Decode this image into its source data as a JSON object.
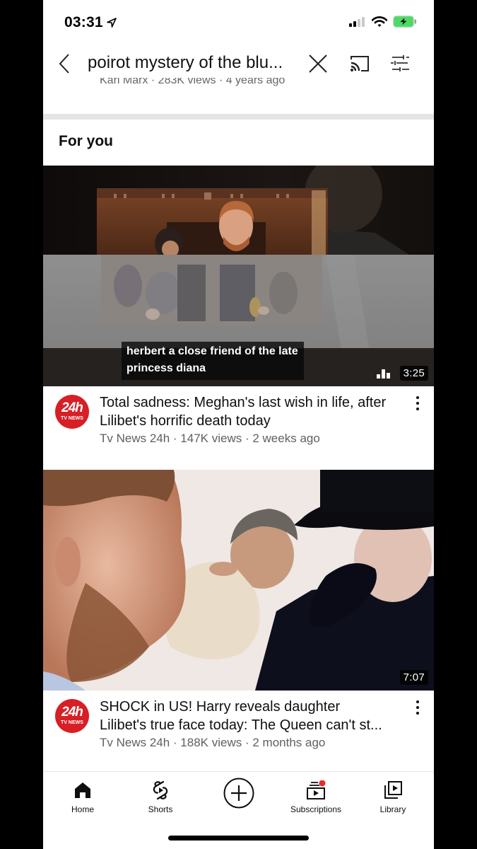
{
  "status_bar": {
    "time": "03:31",
    "location_icon": "location-arrow-icon",
    "signal_icon": "cellular-signal-icon",
    "wifi_icon": "wifi-icon",
    "battery_icon": "battery-charging-icon",
    "battery_color": "#4cd964"
  },
  "search_header": {
    "back_icon": "chevron-left-icon",
    "query": "poirot mystery of the blu...",
    "clear_icon": "close-icon",
    "cast_icon": "cast-icon",
    "filter_icon": "filter-sliders-icon"
  },
  "peek_previous_result": {
    "meta": "Karl Marx · 283K views · 4 years ago"
  },
  "section": {
    "title": "For you"
  },
  "videos": [
    {
      "title": "Total sadness: Meghan's last wish in life, after Lilibet's horrific death today",
      "channel": "Tv News 24h",
      "views": "147K views",
      "age": "2 weeks ago",
      "meta": "Tv News 24h · 147K views · 2 weeks ago",
      "duration": "3:25",
      "captions": [
        "herbert a close friend of the late",
        "princess diana"
      ],
      "avatar": {
        "big": "24h",
        "small": "TV NEWS",
        "color": "#d71f25"
      },
      "more_icon": "more-vertical-icon"
    },
    {
      "title": "SHOCK in US! Harry reveals daughter Lilibet's true face today: The Queen can't st...",
      "channel": "Tv News 24h",
      "views": "188K views",
      "age": "2 months ago",
      "meta": "Tv News 24h · 188K views · 2 months ago",
      "duration": "7:07",
      "avatar": {
        "big": "24h",
        "small": "TV NEWS",
        "color": "#d71f25"
      },
      "more_icon": "more-vertical-icon"
    }
  ],
  "bottom_nav": {
    "items": [
      {
        "label": "Home",
        "icon": "home-icon",
        "active": true
      },
      {
        "label": "Shorts",
        "icon": "shorts-icon"
      },
      {
        "label": "",
        "icon": "create-plus-icon"
      },
      {
        "label": "Subscriptions",
        "icon": "subscriptions-icon",
        "badge": true,
        "badge_color": "#e52d27"
      },
      {
        "label": "Library",
        "icon": "library-icon"
      }
    ]
  }
}
